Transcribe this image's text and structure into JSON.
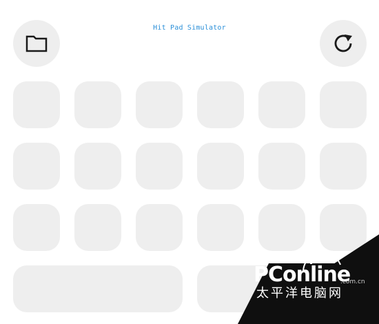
{
  "app": {
    "title": "Hit Pad Simulator"
  },
  "toolbar": {
    "open_icon": "folder-icon",
    "reset_icon": "rotate-clockwise-icon"
  },
  "grid": {
    "rows": 3,
    "columns": 6,
    "bottom_row": 2
  },
  "watermark": {
    "brand": "PConline",
    "suffix": ".com.cn",
    "subtitle": "太平洋电脑网"
  },
  "colors": {
    "pad": "#eeeeee",
    "title": "#2a8fd8",
    "icon": "#1a1a1a"
  }
}
